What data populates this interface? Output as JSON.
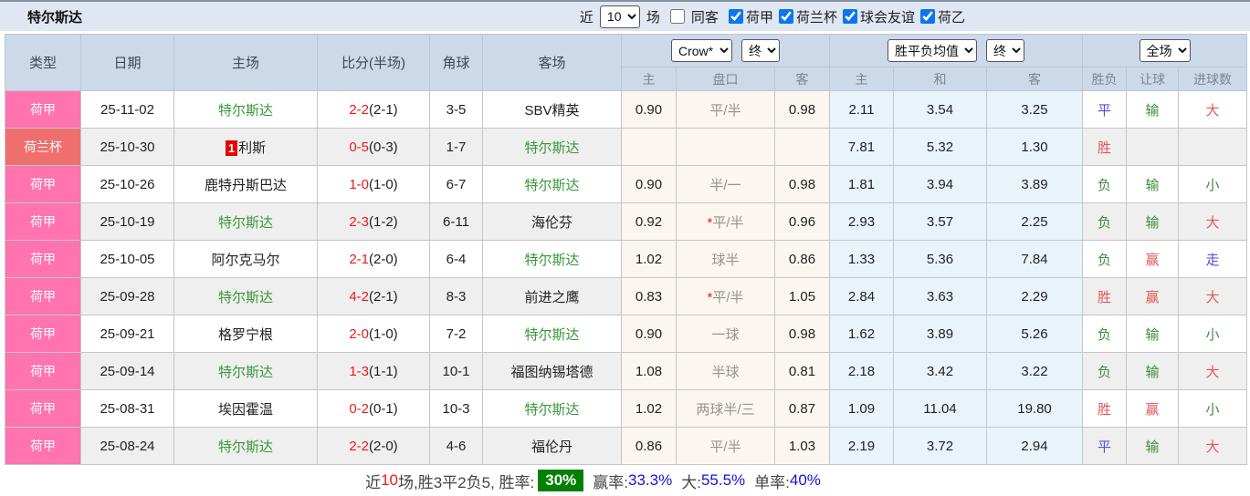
{
  "topbar": {
    "title": "特尔斯达",
    "recent_label": "近",
    "recent_value": "10",
    "matches_label": "场",
    "same_opponent_label": "同客",
    "same_opponent_checked": false,
    "league_filters": [
      {
        "label": "荷甲",
        "checked": true
      },
      {
        "label": "荷兰杯",
        "checked": true
      },
      {
        "label": "球会友谊",
        "checked": true
      },
      {
        "label": "荷乙",
        "checked": true
      }
    ]
  },
  "controls": {
    "odds_company": "Crow*",
    "odds_time": "终",
    "avg_label": "胜平负均值",
    "avg_time": "终",
    "scope": "全场"
  },
  "table": {
    "main_headers": [
      "类型",
      "日期",
      "主场",
      "比分(半场)",
      "角球",
      "客场"
    ],
    "subheaders": [
      "主",
      "盘口",
      "客",
      "主",
      "和",
      "客",
      "胜负",
      "让球",
      "进球数"
    ],
    "rows": [
      {
        "league": "荷甲",
        "league_class": "league-pink",
        "date": "25-11-02",
        "home": "特尔斯达",
        "home_hl": true,
        "home_badge": "",
        "score": "2-2",
        "half": "(2-1)",
        "corners": "3-5",
        "away": "SBV精英",
        "away_hl": false,
        "odds_home": "0.90",
        "handicap": "平/半",
        "handicap_star": false,
        "odds_away": "0.98",
        "avg_win": "2.11",
        "avg_draw": "3.54",
        "avg_lose": "3.25",
        "result": "平",
        "result_color": "blue",
        "let_result": "输",
        "let_color": "green",
        "goals": "大",
        "goals_color": "red"
      },
      {
        "league": "荷兰杯",
        "league_class": "league-red",
        "date": "25-10-30",
        "home": "利斯",
        "home_hl": false,
        "home_badge": "1",
        "score": "0-5",
        "half": "(0-3)",
        "corners": "1-7",
        "away": "特尔斯达",
        "away_hl": true,
        "odds_home": "",
        "handicap": "",
        "handicap_star": false,
        "odds_away": "",
        "avg_win": "7.81",
        "avg_draw": "5.32",
        "avg_lose": "1.30",
        "result": "胜",
        "result_color": "red",
        "let_result": "",
        "let_color": "",
        "goals": "",
        "goals_color": ""
      },
      {
        "league": "荷甲",
        "league_class": "league-pink",
        "date": "25-10-26",
        "home": "鹿特丹斯巴达",
        "home_hl": false,
        "home_badge": "",
        "score": "1-0",
        "half": "(1-0)",
        "corners": "6-7",
        "away": "特尔斯达",
        "away_hl": true,
        "odds_home": "0.90",
        "handicap": "半/一",
        "handicap_star": false,
        "odds_away": "0.98",
        "avg_win": "1.81",
        "avg_draw": "3.94",
        "avg_lose": "3.89",
        "result": "负",
        "result_color": "green",
        "let_result": "输",
        "let_color": "green",
        "goals": "小",
        "goals_color": "green"
      },
      {
        "league": "荷甲",
        "league_class": "league-pink",
        "date": "25-10-19",
        "home": "特尔斯达",
        "home_hl": true,
        "home_badge": "",
        "score": "2-3",
        "half": "(1-2)",
        "corners": "6-11",
        "away": "海伦芬",
        "away_hl": false,
        "odds_home": "0.92",
        "handicap": "平/半",
        "handicap_star": true,
        "odds_away": "0.96",
        "avg_win": "2.93",
        "avg_draw": "3.57",
        "avg_lose": "2.25",
        "result": "负",
        "result_color": "green",
        "let_result": "输",
        "let_color": "green",
        "goals": "大",
        "goals_color": "red"
      },
      {
        "league": "荷甲",
        "league_class": "league-pink",
        "date": "25-10-05",
        "home": "阿尔克马尔",
        "home_hl": false,
        "home_badge": "",
        "score": "2-1",
        "half": "(2-0)",
        "corners": "6-4",
        "away": "特尔斯达",
        "away_hl": true,
        "odds_home": "1.02",
        "handicap": "球半",
        "handicap_star": false,
        "odds_away": "0.86",
        "avg_win": "1.33",
        "avg_draw": "5.36",
        "avg_lose": "7.84",
        "result": "负",
        "result_color": "green",
        "let_result": "赢",
        "let_color": "red",
        "goals": "走",
        "goals_color": "blue"
      },
      {
        "league": "荷甲",
        "league_class": "league-pink",
        "date": "25-09-28",
        "home": "特尔斯达",
        "home_hl": true,
        "home_badge": "",
        "score": "4-2",
        "half": "(2-1)",
        "corners": "8-3",
        "away": "前进之鹰",
        "away_hl": false,
        "odds_home": "0.83",
        "handicap": "平/半",
        "handicap_star": true,
        "odds_away": "1.05",
        "avg_win": "2.84",
        "avg_draw": "3.63",
        "avg_lose": "2.29",
        "result": "胜",
        "result_color": "red",
        "let_result": "赢",
        "let_color": "red",
        "goals": "大",
        "goals_color": "red"
      },
      {
        "league": "荷甲",
        "league_class": "league-pink",
        "date": "25-09-21",
        "home": "格罗宁根",
        "home_hl": false,
        "home_badge": "",
        "score": "2-0",
        "half": "(1-0)",
        "corners": "7-2",
        "away": "特尔斯达",
        "away_hl": true,
        "odds_home": "0.90",
        "handicap": "一球",
        "handicap_star": false,
        "odds_away": "0.98",
        "avg_win": "1.62",
        "avg_draw": "3.89",
        "avg_lose": "5.26",
        "result": "负",
        "result_color": "green",
        "let_result": "输",
        "let_color": "green",
        "goals": "小",
        "goals_color": "green"
      },
      {
        "league": "荷甲",
        "league_class": "league-pink",
        "date": "25-09-14",
        "home": "特尔斯达",
        "home_hl": true,
        "home_badge": "",
        "score": "1-3",
        "half": "(1-1)",
        "corners": "10-1",
        "away": "福图纳锡塔德",
        "away_hl": false,
        "odds_home": "1.08",
        "handicap": "半球",
        "handicap_star": false,
        "odds_away": "0.81",
        "avg_win": "2.18",
        "avg_draw": "3.42",
        "avg_lose": "3.22",
        "result": "负",
        "result_color": "green",
        "let_result": "输",
        "let_color": "green",
        "goals": "大",
        "goals_color": "red"
      },
      {
        "league": "荷甲",
        "league_class": "league-pink",
        "date": "25-08-31",
        "home": "埃因霍温",
        "home_hl": false,
        "home_badge": "",
        "score": "0-2",
        "half": "(0-1)",
        "corners": "10-3",
        "away": "特尔斯达",
        "away_hl": true,
        "odds_home": "1.02",
        "handicap": "两球半/三",
        "handicap_star": false,
        "odds_away": "0.87",
        "avg_win": "1.09",
        "avg_draw": "11.04",
        "avg_lose": "19.80",
        "result": "胜",
        "result_color": "red",
        "let_result": "赢",
        "let_color": "red",
        "goals": "小",
        "goals_color": "green"
      },
      {
        "league": "荷甲",
        "league_class": "league-pink",
        "date": "25-08-24",
        "home": "特尔斯达",
        "home_hl": true,
        "home_badge": "",
        "score": "2-2",
        "half": "(2-0)",
        "corners": "4-6",
        "away": "福伦丹",
        "away_hl": false,
        "odds_home": "0.86",
        "handicap": "平/半",
        "handicap_star": false,
        "odds_away": "1.03",
        "avg_win": "2.19",
        "avg_draw": "3.72",
        "avg_lose": "2.94",
        "result": "平",
        "result_color": "blue",
        "let_result": "输",
        "let_color": "green",
        "goals": "大",
        "goals_color": "red"
      }
    ]
  },
  "footer": {
    "part1": "近",
    "count": "10",
    "part2": "场,胜3平2负5, 胜率:",
    "rate_value": "30%",
    "win_label": "赢率:",
    "win_value": "33.3%",
    "big_label": "大:",
    "big_value": "55.5%",
    "single_label": "单率:",
    "single_value": "40%"
  },
  "colors": {
    "accent_pink": "#ff73ae",
    "accent_red": "#ef6f6f",
    "team_green": "#389738",
    "score_red": "#f01818",
    "result_red": "#e25757",
    "result_green": "#3f8c3f",
    "result_blue": "#4f4fe0",
    "header_bg": "#ccd9e9",
    "topbar_bg": "#dfe7f2",
    "win_rate_bg": "#008000",
    "footer_value_blue": "#1414d2"
  }
}
